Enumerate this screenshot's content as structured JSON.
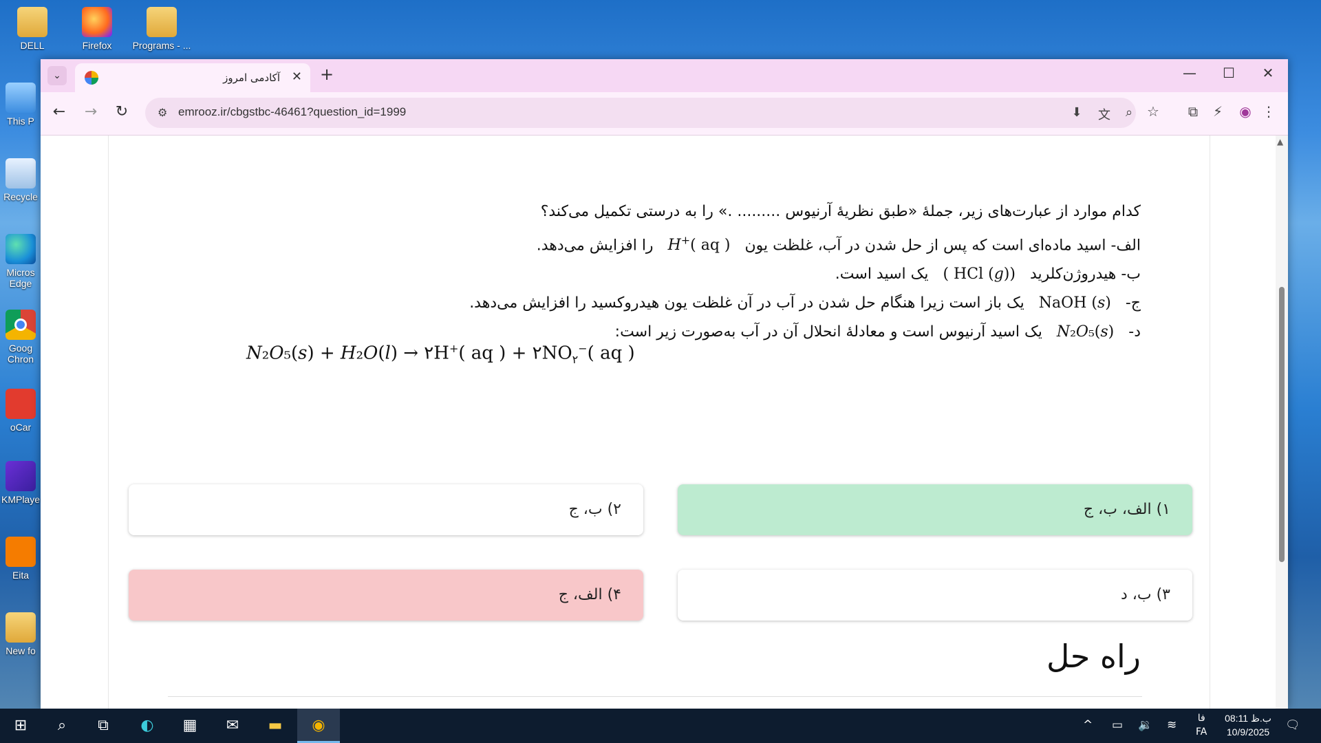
{
  "desktop": {
    "icons": [
      {
        "label": "DELL"
      },
      {
        "label": "Firefox"
      },
      {
        "label": "Programs - ..."
      },
      {
        "label": "This P"
      },
      {
        "label": "Recycle"
      },
      {
        "label": "Micros Edge"
      },
      {
        "label": "Goog Chron"
      },
      {
        "label": "oCar"
      },
      {
        "label": "KMPlaye"
      },
      {
        "label": "Eita"
      },
      {
        "label": "New fo"
      }
    ]
  },
  "browser": {
    "tab_title": "آکادمی امروز",
    "url": "emrooz.ir/cbgstbc-46461?question_id=1999"
  },
  "question": {
    "line1": "کدام موارد از عبارت‌های زیر، جملهٔ «طبق نظریهٔ آرنیوس ......... .» را به درستی تکمیل می‌کند؟",
    "line2_a": "الف- اسید ماده‌ای است که پس از حل شدن در آب، غلظت یون",
    "line2_b": "را افزایش می‌دهد.",
    "line3_a": "ب- هیدروژن‌کلرید",
    "line3_b": "یک اسید است.",
    "line4_a": "ج-",
    "line4_b": "یک باز است زیرا هنگام حل شدن در آب در آن غلظت یون هیدروکسید را افزایش می‌دهد.",
    "line5_a": "د-",
    "line5_b": "یک اسید آرنیوس است و معادلهٔ انحلال آن در آب به‌صورت زیر است:"
  },
  "options": [
    {
      "label": "۱) الف، ب، ج",
      "state": "correct"
    },
    {
      "label": "۲) ب، ج",
      "state": "normal"
    },
    {
      "label": "۳) ب، د",
      "state": "normal"
    },
    {
      "label": "۴) الف، ج",
      "state": "wrong"
    }
  ],
  "solution": {
    "title": "راه حل"
  },
  "taskbar": {
    "lang_top": "فا",
    "lang": "FA",
    "time": "08:11 ب.ظ",
    "date": "10/9/2025"
  }
}
